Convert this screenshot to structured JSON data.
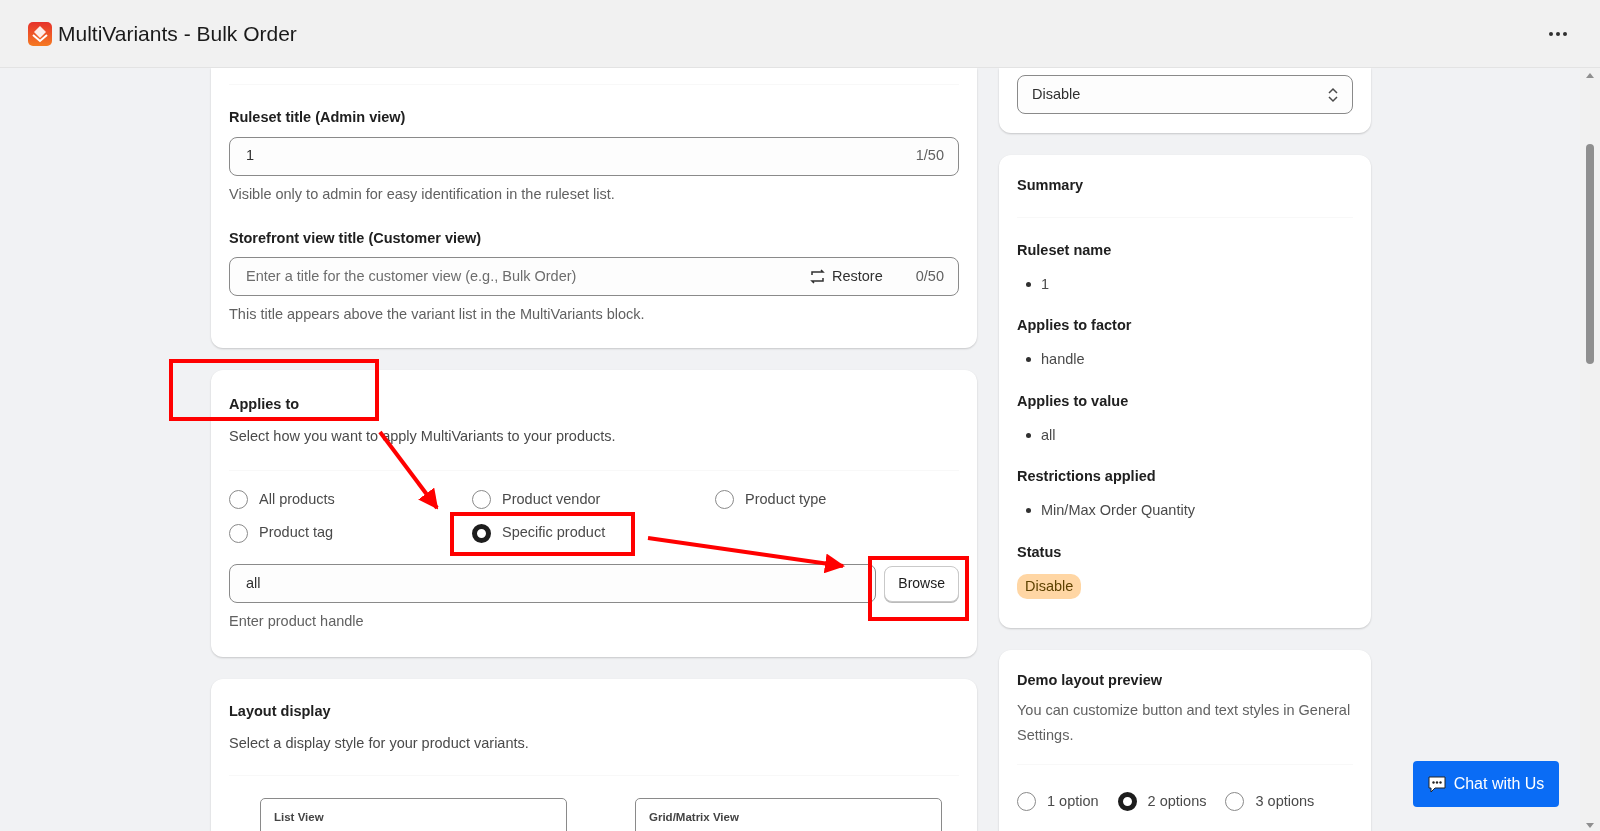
{
  "app": {
    "title": "MultiVariants - Bulk Order"
  },
  "status_select": {
    "value": "Disable"
  },
  "ruleset_title": {
    "label": "Ruleset title (Admin view)",
    "value": "1",
    "counter": "1/50",
    "help": "Visible only to admin for easy identification in the ruleset list."
  },
  "storefront_title": {
    "label": "Storefront view title (Customer view)",
    "placeholder": "Enter a title for the customer view (e.g., Bulk Order)",
    "restore": "Restore",
    "counter": "0/50",
    "help": "This title appears above the variant list in the MultiVariants block."
  },
  "applies_to": {
    "title": "Applies to",
    "description": "Select how you want to apply MultiVariants to your products.",
    "options": [
      {
        "label": "All products",
        "selected": false
      },
      {
        "label": "Product vendor",
        "selected": false
      },
      {
        "label": "Product type",
        "selected": false
      },
      {
        "label": "Product tag",
        "selected": false
      },
      {
        "label": "Specific product",
        "selected": true
      }
    ],
    "handle_input": {
      "value": "all",
      "help": "Enter product handle"
    },
    "browse_button": "Browse"
  },
  "layout_display": {
    "title": "Layout display",
    "description": "Select a display style for your product variants.",
    "views": [
      {
        "label": "List View"
      },
      {
        "label": "Grid/Matrix View"
      }
    ]
  },
  "summary": {
    "title": "Summary",
    "sections": [
      {
        "heading": "Ruleset name",
        "items": [
          "1"
        ]
      },
      {
        "heading": "Applies to factor",
        "items": [
          "handle"
        ]
      },
      {
        "heading": "Applies to value",
        "items": [
          "all"
        ]
      },
      {
        "heading": "Restrictions applied",
        "items": [
          "Min/Max Order Quantity"
        ]
      }
    ],
    "status": {
      "heading": "Status",
      "badge": "Disable"
    }
  },
  "demo_preview": {
    "title": "Demo layout preview",
    "description": "You can customize button and text styles in General Settings.",
    "options": [
      {
        "label": "1 option",
        "selected": false
      },
      {
        "label": "2 options",
        "selected": true
      },
      {
        "label": "3 options",
        "selected": false
      }
    ]
  },
  "chat_button": {
    "label": "Chat with Us"
  }
}
